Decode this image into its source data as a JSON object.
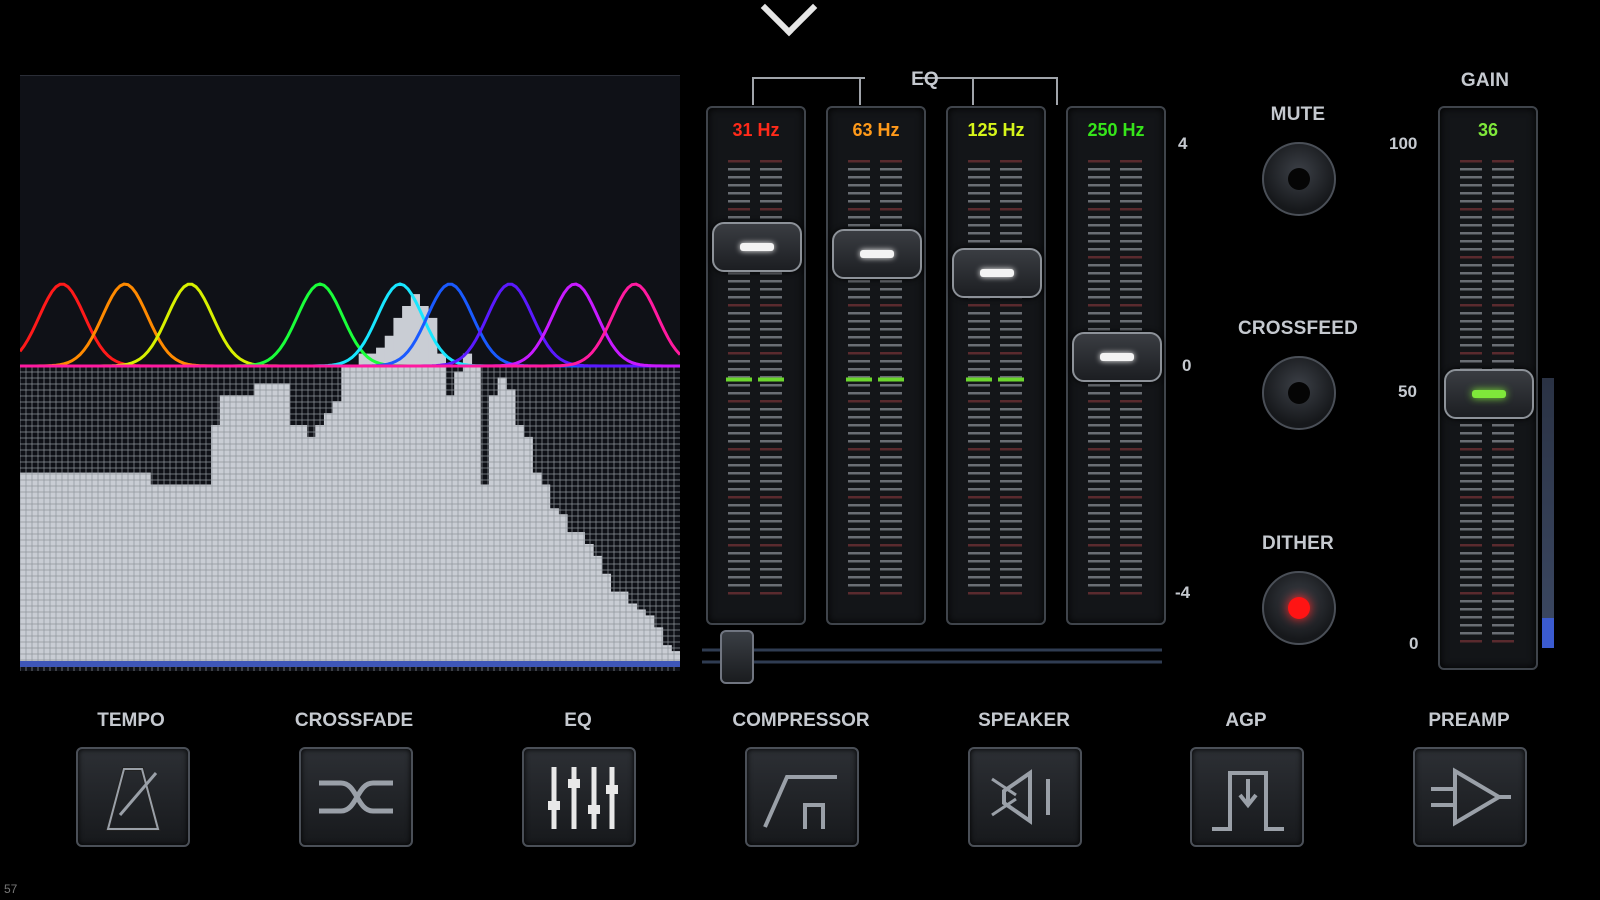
{
  "eq": {
    "title": "EQ",
    "bands": [
      {
        "label": "31 Hz",
        "color": "#ff2a1a",
        "level": 0.82
      },
      {
        "label": "63 Hz",
        "color": "#ff9a1a",
        "level": 0.8
      },
      {
        "label": "125 Hz",
        "color": "#d6f51a",
        "level": 0.75
      },
      {
        "label": "250 Hz",
        "color": "#36e51a",
        "level": 0.52
      }
    ],
    "scale": {
      "top": "4",
      "mid": "0",
      "bottom": "-4"
    }
  },
  "toggles": {
    "mute": {
      "label": "MUTE",
      "on": false
    },
    "crossfeed": {
      "label": "CROSSFEED",
      "on": false
    },
    "dither": {
      "label": "DITHER",
      "on": true
    }
  },
  "gain": {
    "title": "GAIN",
    "value": "36",
    "level": 0.36,
    "scale": {
      "top": "100",
      "mid": "50",
      "bottom": "0"
    }
  },
  "toolbar": [
    {
      "label": "TEMPO",
      "icon": "metronome-icon"
    },
    {
      "label": "CROSSFADE",
      "icon": "shuffle-icon"
    },
    {
      "label": "EQ",
      "icon": "equalizer-sliders-icon"
    },
    {
      "label": "COMPRESSOR",
      "icon": "compressor-curve-icon"
    },
    {
      "label": "SPEAKER",
      "icon": "speaker-icon"
    },
    {
      "label": "AGP",
      "icon": "gate-icon"
    },
    {
      "label": "PREAMP",
      "icon": "amplifier-icon"
    }
  ],
  "status_number": "57",
  "colors": {
    "accent_green": "#7fe83a",
    "dither_red": "#ff1414",
    "vu_blue": "#3b5bd0"
  }
}
